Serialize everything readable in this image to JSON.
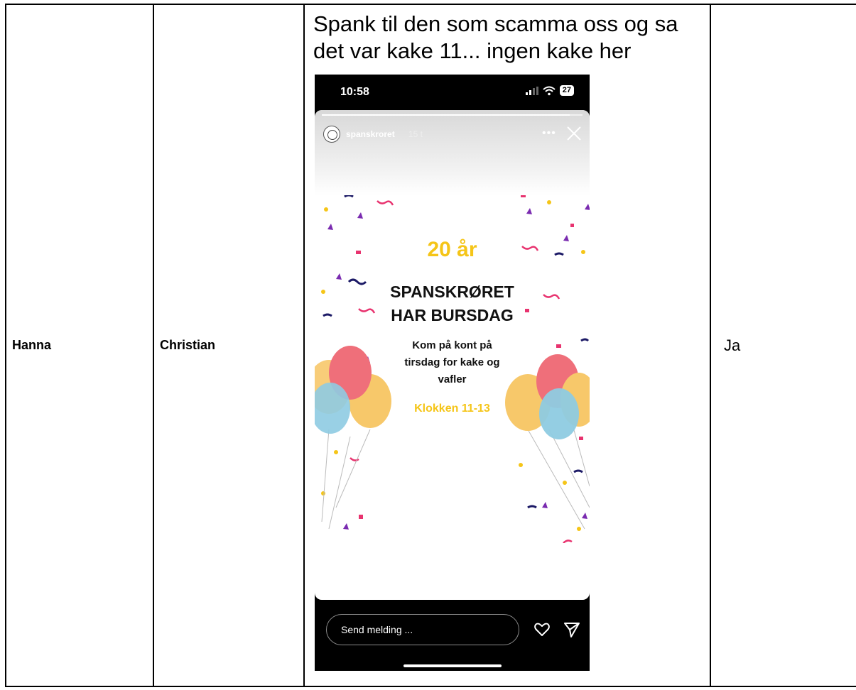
{
  "row": {
    "name_1": "Hanna",
    "name_2": "Christian",
    "comment": "Spank til den som scamma oss og sa det var kake 11... ingen kake her",
    "answer": "Ja"
  },
  "phone": {
    "status": {
      "time": "10:58",
      "battery": "27"
    },
    "story": {
      "account": "spanskroret",
      "age": "15 t",
      "progress": 0.95,
      "card": {
        "title": "20 år",
        "heading_line1": "SPANSKRØRET",
        "heading_line2": "HAR BURSDAG",
        "body_line1": "Kom på kont på",
        "body_line2": "tirsdag for kake og",
        "body_line3": "vafler",
        "time": "Klokken 11-13"
      }
    },
    "reply": {
      "placeholder": "Send melding ..."
    },
    "colors": {
      "accent_yellow": "#f5c518",
      "confetti_pink": "#e8336f",
      "confetti_navy": "#1c1a66",
      "confetti_purple": "#7a2bb0"
    },
    "icons": [
      "wifi-icon",
      "signal-icon",
      "battery-icon",
      "more-icon",
      "close-icon",
      "heart-icon",
      "send-icon"
    ]
  }
}
